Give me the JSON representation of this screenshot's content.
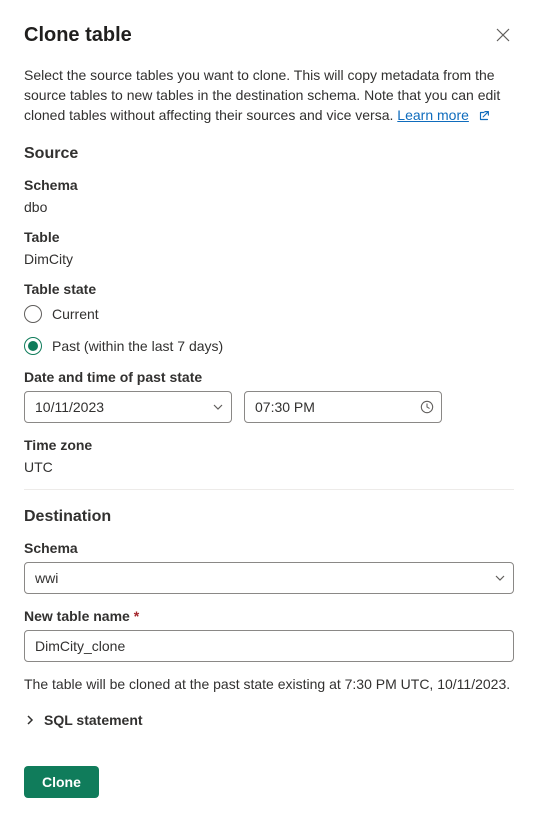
{
  "dialog": {
    "title": "Clone table",
    "description": "Select the source tables you want to clone. This will copy metadata from the source tables to new tables in the destination schema. Note that you can edit cloned tables without affecting their sources and vice versa. ",
    "learn_more": "Learn more"
  },
  "source": {
    "heading": "Source",
    "schema_label": "Schema",
    "schema_value": "dbo",
    "table_label": "Table",
    "table_value": "DimCity",
    "state_label": "Table state",
    "radio_current": "Current",
    "radio_past": "Past (within the last 7 days)",
    "datetime_label": "Date and time of past state",
    "date_value": "10/11/2023",
    "time_value": "07:30 PM",
    "timezone_label": "Time zone",
    "timezone_value": "UTC"
  },
  "destination": {
    "heading": "Destination",
    "schema_label": "Schema",
    "schema_value": "wwi",
    "new_name_label": "New table name",
    "new_name_value": "DimCity_clone"
  },
  "summary": "The table will be cloned at the past state existing at 7:30 PM UTC, 10/11/2023.",
  "accordion": "SQL statement",
  "actions": {
    "clone": "Clone"
  }
}
